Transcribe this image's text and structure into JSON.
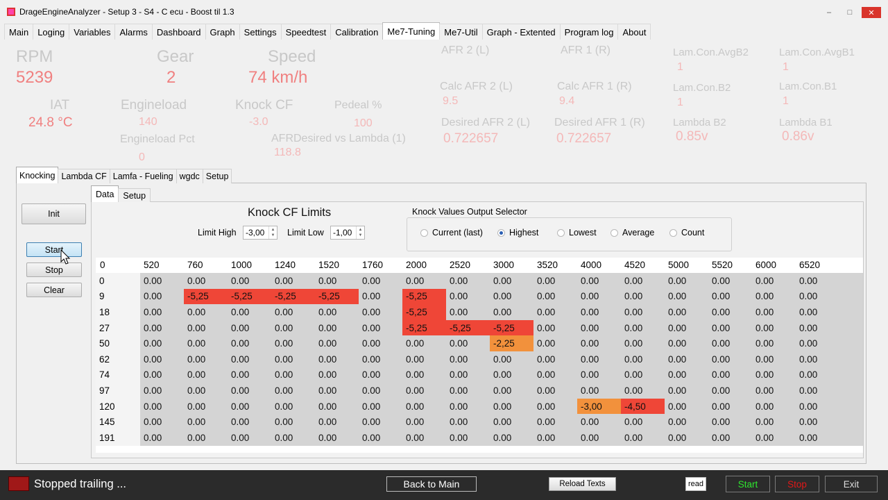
{
  "window": {
    "title": "DrageEngineAnalyzer - Setup 3 - S4 - C ecu - Boost til 1.3",
    "minimize": "–",
    "maximize": "□",
    "close": "✕"
  },
  "main_tabs": [
    "Main",
    "Loging",
    "Variables",
    "Alarms",
    "Dashboard",
    "Graph",
    "Settings",
    "Speedtest",
    "Calibration",
    "Me7-Tuning",
    "Me7-Util",
    "Graph - Extented",
    "Program log",
    "About"
  ],
  "main_tab_active": "Me7-Tuning",
  "gauges": {
    "rpm_label": "RPM",
    "rpm_value": "5239",
    "gear_label": "Gear",
    "gear_value": "2",
    "speed_label": "Speed",
    "speed_value": "74 km/h",
    "iat_label": "IAT",
    "iat_value": "24.8 °C",
    "engineload_label": "Engineload",
    "engineload_value": "140",
    "engineload_pct_label": "Engineload Pct",
    "engineload_pct_value": "0",
    "knockcf_label": "Knock CF",
    "knockcf_value": "-3.0",
    "pedal_label": "Pedeal %",
    "pedal_value": "100",
    "afrdesired_label": "AFRDesired vs Lambda (1)",
    "afrdesired_value": "118.8",
    "afr2_label": "AFR  2 (L)",
    "afr1_label": "AFR  1 (R)",
    "calc_afr2_label": "Calc AFR  2 (L)",
    "calc_afr2_value": "9.5",
    "calc_afr1_label": "Calc AFR  1 (R)",
    "calc_afr1_value": "9.4",
    "desired_afr2_label": "Desired AFR  2 (L)",
    "desired_afr2_value": "0.722657",
    "desired_afr1_label": "Desired AFR  1 (R)",
    "desired_afr1_value": "0.722657",
    "lamcon_avgb2_label": "Lam.Con.AvgB2",
    "lamcon_avgb2_value": "1",
    "lamcon_avgb1_label": "Lam.Con.AvgB1",
    "lamcon_avgb1_value": "1",
    "lamcon_b2_label": "Lam.Con.B2",
    "lamcon_b2_value": "1",
    "lamcon_b1_label": "Lam.Con.B1",
    "lamcon_b1_value": "1",
    "lambda_b2_label": "Lambda B2",
    "lambda_b2_value": "0.85v",
    "lambda_b1_label": "Lambda B1",
    "lambda_b1_value": "0.86v"
  },
  "sub_tabs": [
    "Knocking",
    "Lambda CF",
    "Lamfa - Fueling",
    "wgdc",
    "Setup"
  ],
  "inner_tabs": [
    "Data",
    "Setup"
  ],
  "buttons": {
    "init": "Init",
    "start": "Start",
    "stop": "Stop",
    "clear": "Clear"
  },
  "knock": {
    "title": "Knock CF Limits",
    "limit_high_label": "Limit High",
    "limit_high_value": "-3,00",
    "limit_low_label": "Limit Low",
    "limit_low_value": "-1,00"
  },
  "selector": {
    "title": "Knock Values Output Selector",
    "options": [
      "Current (last)",
      "Highest",
      "Lowest",
      "Average",
      "Count"
    ],
    "selected": "Highest"
  },
  "table": {
    "corner": "0",
    "columns": [
      "520",
      "760",
      "1000",
      "1240",
      "1520",
      "1760",
      "2000",
      "2520",
      "3000",
      "3520",
      "4000",
      "4520",
      "5000",
      "5520",
      "6000",
      "6520"
    ],
    "rows": [
      {
        "label": "0",
        "cells": [
          "0.00",
          "0.00",
          "0.00",
          "0.00",
          "0.00",
          "0.00",
          "0.00",
          "0.00",
          "0.00",
          "0.00",
          "0.00",
          "0.00",
          "0.00",
          "0.00",
          "0.00",
          "0.00"
        ]
      },
      {
        "label": "9",
        "cells": [
          "0.00",
          "-5,25",
          "-5,25",
          "-5,25",
          "-5,25",
          "0.00",
          "-5,25",
          "0.00",
          "0.00",
          "0.00",
          "0.00",
          "0.00",
          "0.00",
          "0.00",
          "0.00",
          "0.00"
        ]
      },
      {
        "label": "18",
        "cells": [
          "0.00",
          "0.00",
          "0.00",
          "0.00",
          "0.00",
          "0.00",
          "-5,25",
          "0.00",
          "0.00",
          "0.00",
          "0.00",
          "0.00",
          "0.00",
          "0.00",
          "0.00",
          "0.00"
        ]
      },
      {
        "label": "27",
        "cells": [
          "0.00",
          "0.00",
          "0.00",
          "0.00",
          "0.00",
          "0.00",
          "-5,25",
          "-5,25",
          "-5,25",
          "0.00",
          "0.00",
          "0.00",
          "0.00",
          "0.00",
          "0.00",
          "0.00"
        ]
      },
      {
        "label": "50",
        "cells": [
          "0.00",
          "0.00",
          "0.00",
          "0.00",
          "0.00",
          "0.00",
          "0.00",
          "0.00",
          "-2,25",
          "0.00",
          "0.00",
          "0.00",
          "0.00",
          "0.00",
          "0.00",
          "0.00"
        ]
      },
      {
        "label": "62",
        "cells": [
          "0.00",
          "0.00",
          "0.00",
          "0.00",
          "0.00",
          "0.00",
          "0.00",
          "0.00",
          "0.00",
          "0.00",
          "0.00",
          "0.00",
          "0.00",
          "0.00",
          "0.00",
          "0.00"
        ]
      },
      {
        "label": "74",
        "cells": [
          "0.00",
          "0.00",
          "0.00",
          "0.00",
          "0.00",
          "0.00",
          "0.00",
          "0.00",
          "0.00",
          "0.00",
          "0.00",
          "0.00",
          "0.00",
          "0.00",
          "0.00",
          "0.00"
        ]
      },
      {
        "label": "97",
        "cells": [
          "0.00",
          "0.00",
          "0.00",
          "0.00",
          "0.00",
          "0.00",
          "0.00",
          "0.00",
          "0.00",
          "0.00",
          "0.00",
          "0.00",
          "0.00",
          "0.00",
          "0.00",
          "0.00"
        ]
      },
      {
        "label": "120",
        "cells": [
          "0.00",
          "0.00",
          "0.00",
          "0.00",
          "0.00",
          "0.00",
          "0.00",
          "0.00",
          "0.00",
          "0.00",
          "-3,00",
          "-4,50",
          "0.00",
          "0.00",
          "0.00",
          "0.00"
        ]
      },
      {
        "label": "145",
        "cells": [
          "0.00",
          "0.00",
          "0.00",
          "0.00",
          "0.00",
          "0.00",
          "0.00",
          "0.00",
          "0.00",
          "0.00",
          "0.00",
          "0.00",
          "0.00",
          "0.00",
          "0.00",
          "0.00"
        ]
      },
      {
        "label": "191",
        "cells": [
          "0.00",
          "0.00",
          "0.00",
          "0.00",
          "0.00",
          "0.00",
          "0.00",
          "0.00",
          "0.00",
          "0.00",
          "0.00",
          "0.00",
          "0.00",
          "0.00",
          "0.00",
          "0.00"
        ]
      }
    ],
    "colors": {
      "cell": "#d4d4d4",
      "severe": "#ef4637",
      "moderate": "#f2913c"
    }
  },
  "status": {
    "text": "Stopped trailing ...",
    "back": "Back to Main",
    "reload": "Reload Texts",
    "read": "read",
    "start": "Start",
    "stop": "Stop",
    "exit": "Exit"
  }
}
